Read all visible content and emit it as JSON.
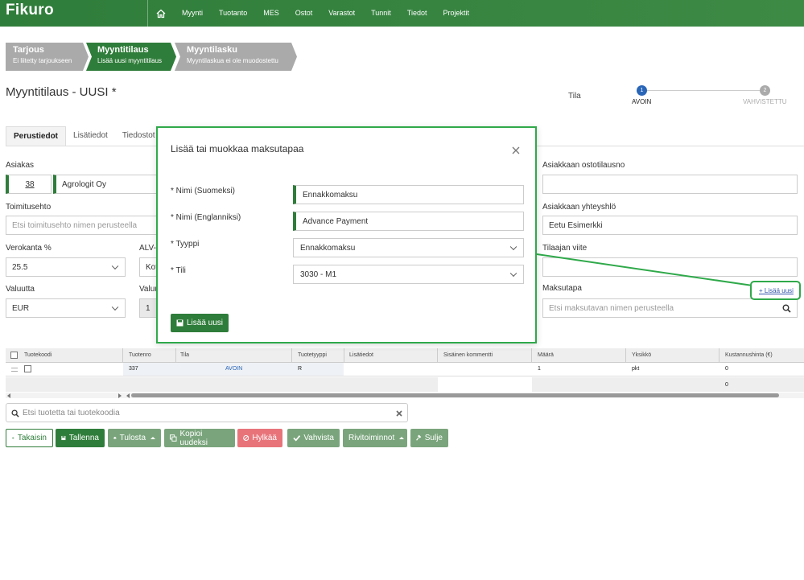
{
  "app": {
    "logo": "Fikuro"
  },
  "nav": {
    "items": [
      "Myynti",
      "Tuotanto",
      "MES",
      "Ostot",
      "Varastot",
      "Tunnit",
      "Tiedot",
      "Projektit"
    ]
  },
  "steps": [
    {
      "title": "Tarjous",
      "sub": "Ei liitetty tarjoukseen"
    },
    {
      "title": "Myyntitilaus",
      "sub": "Lisää uusi myyntitilaus"
    },
    {
      "title": "Myyntilasku",
      "sub": "Myyntilaskua ei ole muodostettu"
    }
  ],
  "page": {
    "title": "Myyntitilaus - UUSI *"
  },
  "status": {
    "label": "Tila",
    "stages": [
      {
        "num": "1",
        "name": "AVOIN"
      },
      {
        "num": "2",
        "name": "VAHVISTETTU"
      }
    ]
  },
  "tabs": [
    "Perustiedot",
    "Lisätiedot",
    "Tiedostot"
  ],
  "form": {
    "asiakas_label": "Asiakas",
    "asiakas_num": "38",
    "asiakas_name": "Agrologit Oy",
    "toimitusehto_label": "Toimitusehto",
    "toimitusehto_placeholder": "Etsi toimitusehto nimen perusteella",
    "verokanta_label": "Verokanta %",
    "verokanta_value": "25.5",
    "alv_label": "ALV-",
    "alv_value": "Kot",
    "valuutta_label": "Valuutta",
    "valuutta_value": "EUR",
    "valuu_label": "Valuu",
    "valuu_value": "1",
    "ostotilausno_label": "Asiakkaan ostotilausno",
    "yhteyshlo_label": "Asiakkaan yhteyshlö",
    "yhteyshlo_value": "Eetu Esimerkki",
    "viite_label": "Tilaajan viite",
    "maksutapa_label": "Maksutapa",
    "maksutapa_placeholder": "Etsi maksutavan nimen perusteella",
    "add_new_link": "+ Lisää uusi"
  },
  "table": {
    "headers": [
      "Tuotekoodi",
      "Tuotenro",
      "Tila",
      "Tuotetyyppi",
      "Lisätiedot",
      "Sisäinen kommentti",
      "Määrä",
      "Yksikkö",
      "Kustannushinta (€)"
    ],
    "row": {
      "tuotenro": "337",
      "tila": "AVOIN",
      "tuotetyyppi": "R",
      "maara": "1",
      "yksikko": "pkt",
      "kustannus": "0"
    },
    "total": "0"
  },
  "product_search": {
    "placeholder": "Etsi tuotetta tai tuotekoodia"
  },
  "buttons": {
    "back": "Takaisin",
    "save": "Tallenna",
    "print": "Tulosta",
    "copy": "Kopioi uudeksi",
    "reject": "Hylkää",
    "confirm": "Vahvista",
    "row_actions": "Rivitoiminnot",
    "close": "Sulje"
  },
  "modal": {
    "title": "Lisää tai muokkaa maksutapaa",
    "name_fi_label": "* Nimi (Suomeksi)",
    "name_fi_value": "Ennakkomaksu",
    "name_en_label": "* Nimi (Englanniksi)",
    "name_en_value": "Advance Payment",
    "type_label": "* Tyyppi",
    "type_value": "Ennakkomaksu",
    "account_label": "* Tili",
    "account_value": "3030 - M1",
    "add_button": "Lisää uusi"
  },
  "colors": {
    "brand": "#2f7d3a",
    "highlight": "#2fa94a",
    "danger": "#e8747a"
  }
}
